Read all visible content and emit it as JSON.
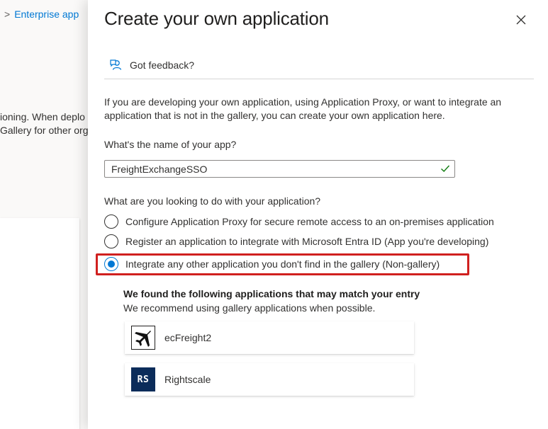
{
  "background": {
    "breadcrumb_separator": ">",
    "breadcrumb_item": "Enterprise app",
    "text_line1": "ioning. When deplo",
    "text_line2": "Gallery for other org"
  },
  "panel": {
    "title": "Create your own application",
    "close_icon": "close-icon",
    "feedback_label": "Got feedback?",
    "description": "If you are developing your own application, using Application Proxy, or want to integrate an application that is not in the gallery, you can create your own application here.",
    "name_label": "What's the name of your app?",
    "name_value": "FreightExchangeSSO",
    "name_valid": true,
    "question_label": "What are you looking to do with your application?",
    "options": [
      {
        "label": "Configure Application Proxy for secure remote access to an on-premises application",
        "selected": false
      },
      {
        "label": "Register an application to integrate with Microsoft Entra ID (App you're developing)",
        "selected": false
      },
      {
        "label": "Integrate any other application you don't find in the gallery (Non-gallery)",
        "selected": true
      }
    ],
    "suggestions": {
      "heading": "We found the following applications that may match your entry",
      "subheading": "We recommend using gallery applications when possible.",
      "apps": [
        {
          "name": "ecFreight2",
          "logo": "airplane-icon"
        },
        {
          "name": "Rightscale",
          "logo": "rightscale-logo",
          "logo_text": "RS"
        }
      ]
    }
  },
  "colors": {
    "accent": "#0078d4",
    "highlight": "#d0201f",
    "valid": "#107c10"
  }
}
